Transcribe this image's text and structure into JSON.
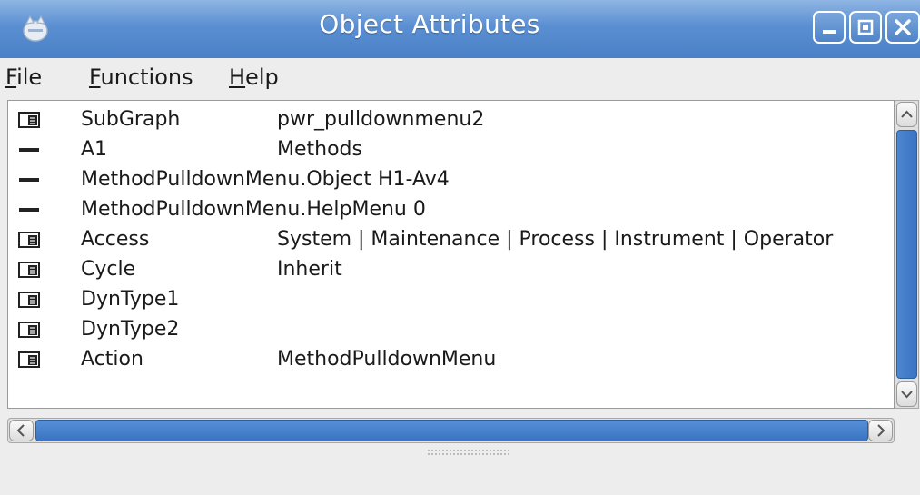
{
  "window": {
    "title": "Object Attributes"
  },
  "menu": {
    "file": {
      "mnemonic": "F",
      "rest": "ile"
    },
    "functions": {
      "mnemonic": "F",
      "rest": "unctions"
    },
    "help": {
      "mnemonic": "H",
      "rest": "elp"
    }
  },
  "rows": [
    {
      "icon": "folder-icon",
      "attribute": "SubGraph",
      "value": "pwr_pulldownmenu2"
    },
    {
      "icon": "dash-icon",
      "attribute": "A1",
      "value": "Methods"
    },
    {
      "icon": "dash-icon",
      "attribute": "MethodPulldownMenu.Object  H1-Av4",
      "value": ""
    },
    {
      "icon": "dash-icon",
      "attribute": "MethodPulldownMenu.HelpMenu  0",
      "value": ""
    },
    {
      "icon": "folder-icon",
      "attribute": "Access",
      "value": "System | Maintenance | Process | Instrument | Operator"
    },
    {
      "icon": "folder-icon",
      "attribute": "Cycle",
      "value": "Inherit"
    },
    {
      "icon": "folder-icon",
      "attribute": "DynType1",
      "value": ""
    },
    {
      "icon": "folder-icon",
      "attribute": "DynType2",
      "value": ""
    },
    {
      "icon": "folder-icon",
      "attribute": "Action",
      "value": "MethodPulldownMenu"
    }
  ],
  "colors": {
    "titlebar": "#5a8fd2",
    "scroll_thumb": "#3a74c2",
    "background": "#ededed"
  }
}
